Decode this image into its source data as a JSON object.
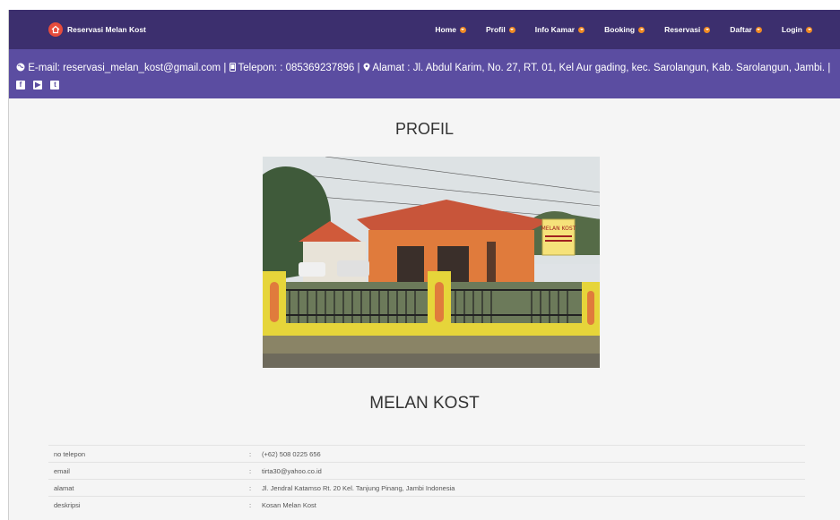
{
  "navbar": {
    "brand": "Reservasi Melan Kost",
    "brand_icon": "home-icon",
    "menu": [
      {
        "label": "Home"
      },
      {
        "label": "Profil"
      },
      {
        "label": "Info Kamar"
      },
      {
        "label": "Booking"
      },
      {
        "label": "Reservasi"
      },
      {
        "label": "Daftar"
      },
      {
        "label": "Login"
      }
    ]
  },
  "contact": {
    "email": "E-mail: reservasi_melan_kost@gmail.com",
    "phone": "Telepon: : 085369237896",
    "address": "Alamat : Jl. Abdul Karim, No. 27, RT. 01, Kel Aur gading, kec. Sarolangun, Kab. Sarolangun, Jambi.",
    "separator": "|"
  },
  "profile": {
    "title": "PROFIL",
    "name": "MELAN KOST",
    "sign_text": "MELAN KOST",
    "rows": [
      {
        "key": "no telepon",
        "sep": ":",
        "value": "(+62) 508 0225 656"
      },
      {
        "key": "email",
        "sep": ":",
        "value": "tirta30@yahoo.co.id"
      },
      {
        "key": "alamat",
        "sep": ":",
        "value": "Jl. Jendral Katamso Rt. 20 Kel. Tanjung Pinang, Jambi Indonesia"
      },
      {
        "key": "deskripsi",
        "sep": ":",
        "value": "Kosan Melan Kost"
      }
    ]
  },
  "colors": {
    "navbar": "#3c2f6e",
    "infobar": "#5b4da1",
    "accent": "#f08a24",
    "brand_logo": "#e74c3c"
  }
}
